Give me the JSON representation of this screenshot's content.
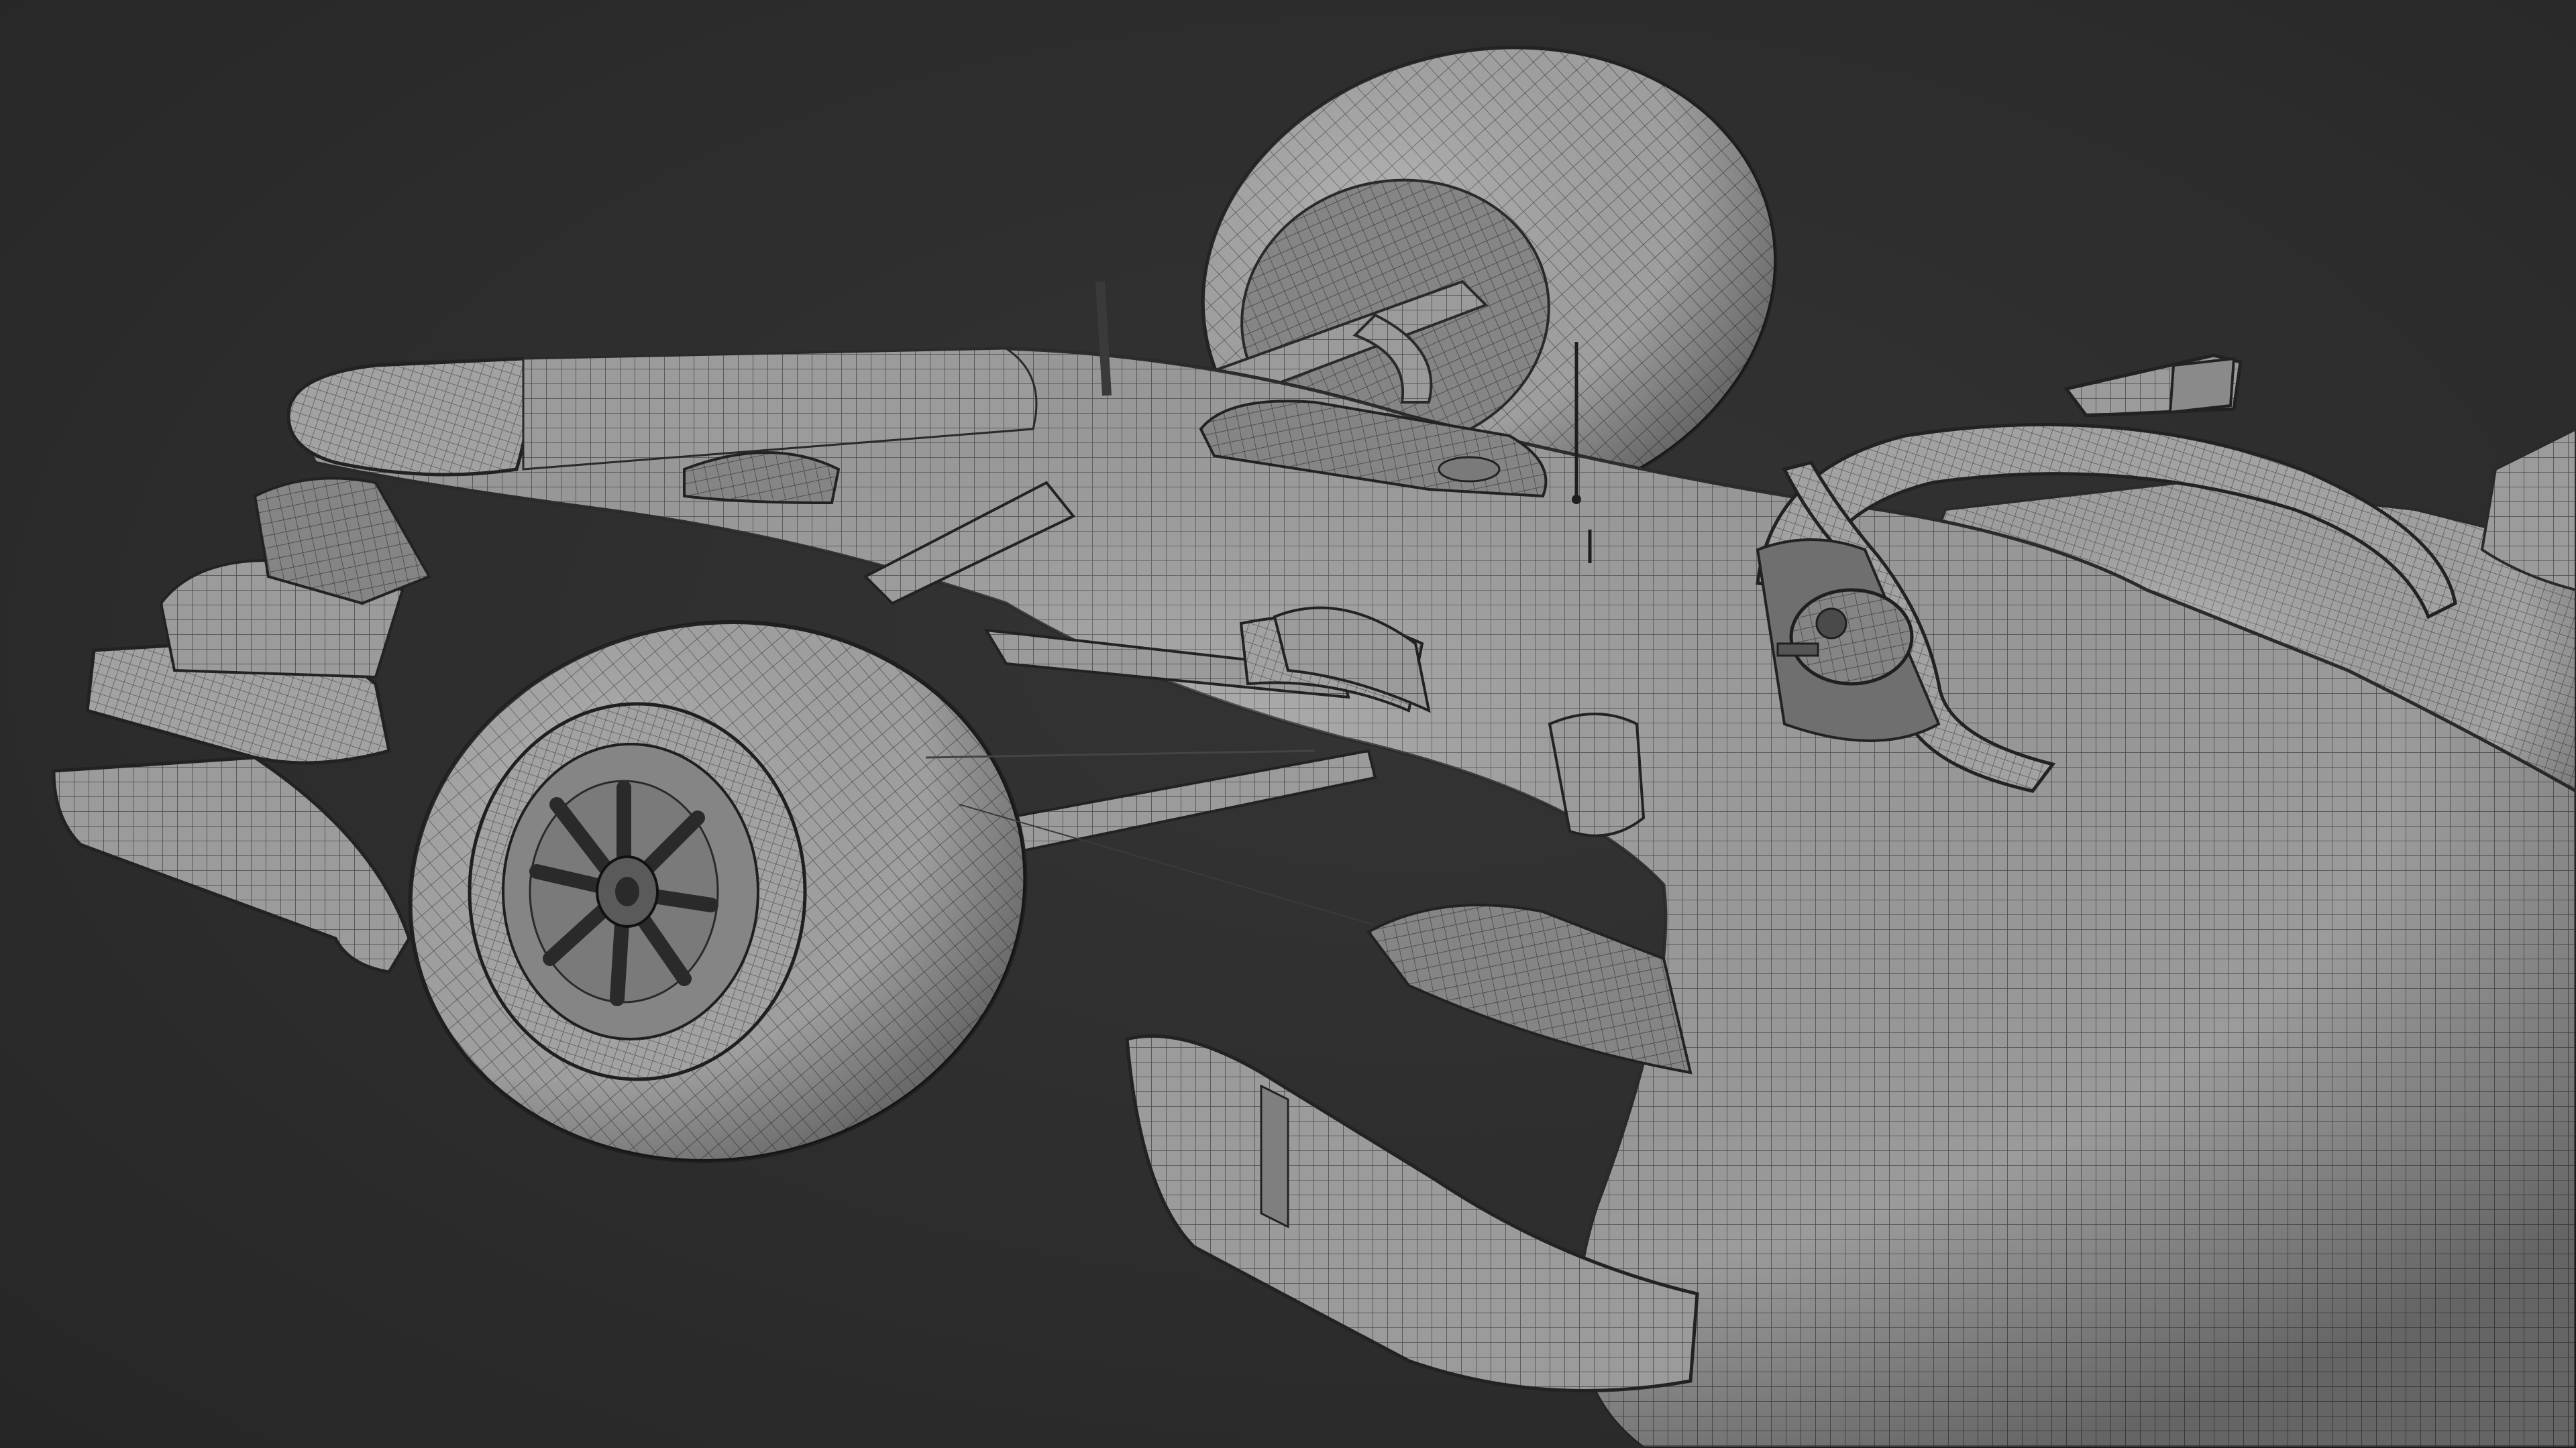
{
  "viewport": {
    "background_color": "#2e2e2e",
    "display_mode": "wireframe-on-shaded",
    "surface_color": "#9a9a9a",
    "wire_color": "#3c3c3c"
  },
  "subject": {
    "parts": [
      "front-wing",
      "nose-cone",
      "front-left-tire",
      "front-right-tire",
      "front-left-rim",
      "front-suspension",
      "chassis-monocoque",
      "halo",
      "cockpit",
      "steering-wheel",
      "rear-view-mirror",
      "bargeboard",
      "sidepod",
      "antenna"
    ]
  }
}
